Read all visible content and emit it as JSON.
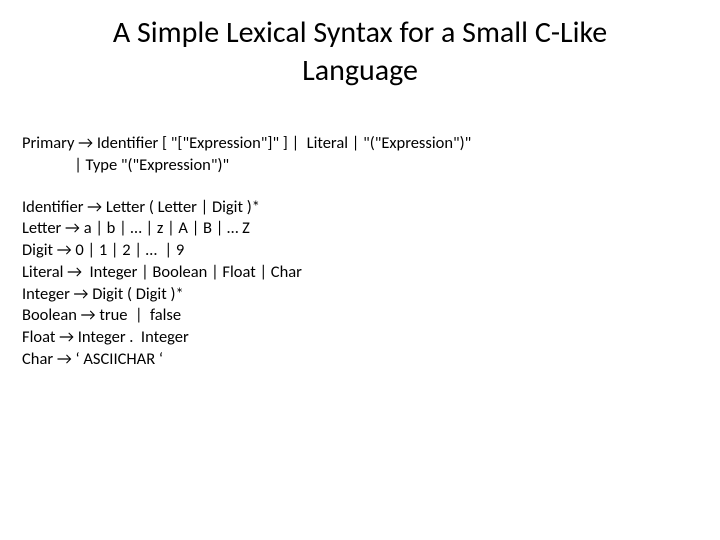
{
  "title": "A Simple Lexical Syntax for a Small C-Like Language",
  "arrow": "→",
  "rules1": {
    "primary_l1": "Primary → Identifier [ \"[\"Expression\"]\" ] |  Literal | \"(\"Expression\")\"",
    "primary_l2": "              | Type \"(\"Expression\")\""
  },
  "rules2": {
    "identifier": "Identifier → Letter ( Letter | Digit )*",
    "letter": "Letter → a | b | … | z | A | B | … Z",
    "digit": "Digit → 0 | 1 | 2 | …  | 9",
    "literal": "Literal →  Integer | Boolean | Float | Char",
    "integer": "Integer → Digit ( Digit )*",
    "boolean": "Boolean → true  |  false",
    "float": "Float → Integer .  Integer",
    "char": "Char → ‘ ASCIICHAR ‘"
  }
}
